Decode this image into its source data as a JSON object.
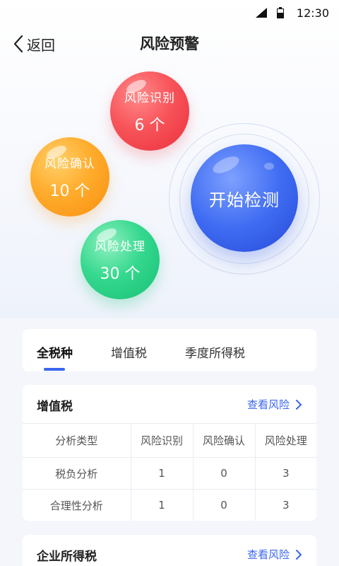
{
  "status_bar": {
    "time": "12:30"
  },
  "nav": {
    "back_label": "返回",
    "title": "风险预警"
  },
  "bubbles": {
    "identify": {
      "title": "风险识别",
      "count": "6 个"
    },
    "confirm": {
      "title": "风险确认",
      "count": "10 个"
    },
    "handle": {
      "title": "风险处理",
      "count": "30 个"
    },
    "detect": {
      "label": "开始检测"
    }
  },
  "tabs": [
    {
      "label": "全税种",
      "active": true
    },
    {
      "label": "增值税",
      "active": false
    },
    {
      "label": "季度所得税",
      "active": false
    }
  ],
  "vat_card": {
    "title": "增值税",
    "link": "查看风险",
    "columns": [
      "分析类型",
      "风险识别",
      "风险确认",
      "风险处理"
    ],
    "rows": [
      [
        "税负分析",
        "1",
        "0",
        "3"
      ],
      [
        "合理性分析",
        "1",
        "0",
        "3"
      ]
    ]
  },
  "cit_card": {
    "title": "企业所得税",
    "link": "查看风险"
  },
  "colors": {
    "accent": "#3a66f0",
    "red": "#f8545a",
    "orange": "#ffac2c",
    "green": "#35d88e",
    "blue": "#3f6cf2"
  }
}
